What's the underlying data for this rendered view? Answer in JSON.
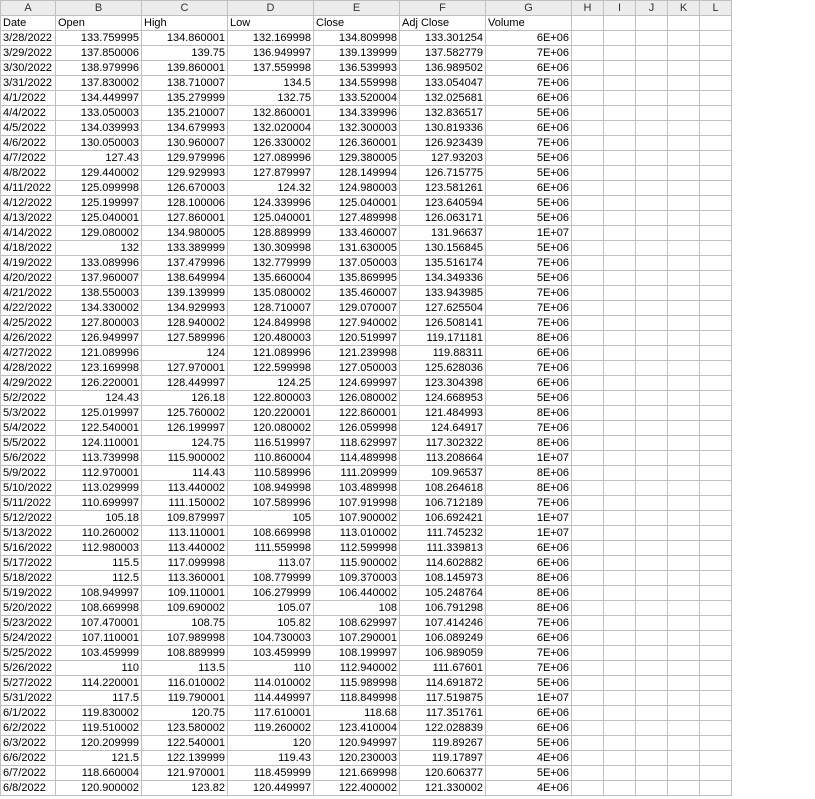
{
  "columns": [
    "A",
    "B",
    "C",
    "D",
    "E",
    "F",
    "G",
    "H",
    "I",
    "J",
    "K",
    "L"
  ],
  "headers": [
    "Date",
    "Open",
    "High",
    "Low",
    "Close",
    "Adj Close",
    "Volume",
    "",
    "",
    "",
    "",
    ""
  ],
  "rows": [
    {
      "date": "3/28/2022",
      "open": "133.759995",
      "high": "134.860001",
      "low": "132.169998",
      "close": "134.809998",
      "adj": "133.301254",
      "vol": "6E+06"
    },
    {
      "date": "3/29/2022",
      "open": "137.850006",
      "high": "139.75",
      "low": "136.949997",
      "close": "139.139999",
      "adj": "137.582779",
      "vol": "7E+06"
    },
    {
      "date": "3/30/2022",
      "open": "138.979996",
      "high": "139.860001",
      "low": "137.559998",
      "close": "136.539993",
      "adj": "136.989502",
      "vol": "6E+06"
    },
    {
      "date": "3/31/2022",
      "open": "137.830002",
      "high": "138.710007",
      "low": "134.5",
      "close": "134.559998",
      "adj": "133.054047",
      "vol": "7E+06"
    },
    {
      "date": "4/1/2022",
      "open": "134.449997",
      "high": "135.279999",
      "low": "132.75",
      "close": "133.520004",
      "adj": "132.025681",
      "vol": "6E+06"
    },
    {
      "date": "4/4/2022",
      "open": "133.050003",
      "high": "135.210007",
      "low": "132.860001",
      "close": "134.339996",
      "adj": "132.836517",
      "vol": "5E+06"
    },
    {
      "date": "4/5/2022",
      "open": "134.039993",
      "high": "134.679993",
      "low": "132.020004",
      "close": "132.300003",
      "adj": "130.819336",
      "vol": "6E+06"
    },
    {
      "date": "4/6/2022",
      "open": "130.050003",
      "high": "130.960007",
      "low": "126.330002",
      "close": "126.360001",
      "adj": "126.923439",
      "vol": "7E+06"
    },
    {
      "date": "4/7/2022",
      "open": "127.43",
      "high": "129.979996",
      "low": "127.089996",
      "close": "129.380005",
      "adj": "127.93203",
      "vol": "5E+06"
    },
    {
      "date": "4/8/2022",
      "open": "129.440002",
      "high": "129.929993",
      "low": "127.879997",
      "close": "128.149994",
      "adj": "126.715775",
      "vol": "5E+06"
    },
    {
      "date": "4/11/2022",
      "open": "125.099998",
      "high": "126.670003",
      "low": "124.32",
      "close": "124.980003",
      "adj": "123.581261",
      "vol": "6E+06"
    },
    {
      "date": "4/12/2022",
      "open": "125.199997",
      "high": "128.100006",
      "low": "124.339996",
      "close": "125.040001",
      "adj": "123.640594",
      "vol": "5E+06"
    },
    {
      "date": "4/13/2022",
      "open": "125.040001",
      "high": "127.860001",
      "low": "125.040001",
      "close": "127.489998",
      "adj": "126.063171",
      "vol": "5E+06"
    },
    {
      "date": "4/14/2022",
      "open": "129.080002",
      "high": "134.980005",
      "low": "128.889999",
      "close": "133.460007",
      "adj": "131.96637",
      "vol": "1E+07"
    },
    {
      "date": "4/18/2022",
      "open": "132",
      "high": "133.389999",
      "low": "130.309998",
      "close": "131.630005",
      "adj": "130.156845",
      "vol": "5E+06"
    },
    {
      "date": "4/19/2022",
      "open": "133.089996",
      "high": "137.479996",
      "low": "132.779999",
      "close": "137.050003",
      "adj": "135.516174",
      "vol": "7E+06"
    },
    {
      "date": "4/20/2022",
      "open": "137.960007",
      "high": "138.649994",
      "low": "135.660004",
      "close": "135.869995",
      "adj": "134.349336",
      "vol": "5E+06"
    },
    {
      "date": "4/21/2022",
      "open": "138.550003",
      "high": "139.139999",
      "low": "135.080002",
      "close": "135.460007",
      "adj": "133.943985",
      "vol": "7E+06"
    },
    {
      "date": "4/22/2022",
      "open": "134.330002",
      "high": "134.929993",
      "low": "128.710007",
      "close": "129.070007",
      "adj": "127.625504",
      "vol": "7E+06"
    },
    {
      "date": "4/25/2022",
      "open": "127.800003",
      "high": "128.940002",
      "low": "124.849998",
      "close": "127.940002",
      "adj": "126.508141",
      "vol": "7E+06"
    },
    {
      "date": "4/26/2022",
      "open": "126.949997",
      "high": "127.589996",
      "low": "120.480003",
      "close": "120.519997",
      "adj": "119.171181",
      "vol": "8E+06"
    },
    {
      "date": "4/27/2022",
      "open": "121.089996",
      "high": "124",
      "low": "121.089996",
      "close": "121.239998",
      "adj": "119.88311",
      "vol": "6E+06"
    },
    {
      "date": "4/28/2022",
      "open": "123.169998",
      "high": "127.970001",
      "low": "122.599998",
      "close": "127.050003",
      "adj": "125.628036",
      "vol": "7E+06"
    },
    {
      "date": "4/29/2022",
      "open": "126.220001",
      "high": "128.449997",
      "low": "124.25",
      "close": "124.699997",
      "adj": "123.304398",
      "vol": "6E+06"
    },
    {
      "date": "5/2/2022",
      "open": "124.43",
      "high": "126.18",
      "low": "122.800003",
      "close": "126.080002",
      "adj": "124.668953",
      "vol": "5E+06"
    },
    {
      "date": "5/3/2022",
      "open": "125.019997",
      "high": "125.760002",
      "low": "120.220001",
      "close": "122.860001",
      "adj": "121.484993",
      "vol": "8E+06"
    },
    {
      "date": "5/4/2022",
      "open": "122.540001",
      "high": "126.199997",
      "low": "120.080002",
      "close": "126.059998",
      "adj": "124.64917",
      "vol": "7E+06"
    },
    {
      "date": "5/5/2022",
      "open": "124.110001",
      "high": "124.75",
      "low": "116.519997",
      "close": "118.629997",
      "adj": "117.302322",
      "vol": "8E+06"
    },
    {
      "date": "5/6/2022",
      "open": "113.739998",
      "high": "115.900002",
      "low": "110.860004",
      "close": "114.489998",
      "adj": "113.208664",
      "vol": "1E+07"
    },
    {
      "date": "5/9/2022",
      "open": "112.970001",
      "high": "114.43",
      "low": "110.589996",
      "close": "111.209999",
      "adj": "109.96537",
      "vol": "8E+06"
    },
    {
      "date": "5/10/2022",
      "open": "113.029999",
      "high": "113.440002",
      "low": "108.949998",
      "close": "103.489998",
      "adj": "108.264618",
      "vol": "8E+06"
    },
    {
      "date": "5/11/2022",
      "open": "110.699997",
      "high": "111.150002",
      "low": "107.589996",
      "close": "107.919998",
      "adj": "106.712189",
      "vol": "7E+06"
    },
    {
      "date": "5/12/2022",
      "open": "105.18",
      "high": "109.879997",
      "low": "105",
      "close": "107.900002",
      "adj": "106.692421",
      "vol": "1E+07"
    },
    {
      "date": "5/13/2022",
      "open": "110.260002",
      "high": "113.110001",
      "low": "108.669998",
      "close": "113.010002",
      "adj": "111.745232",
      "vol": "1E+07"
    },
    {
      "date": "5/16/2022",
      "open": "112.980003",
      "high": "113.440002",
      "low": "111.559998",
      "close": "112.599998",
      "adj": "111.339813",
      "vol": "6E+06"
    },
    {
      "date": "5/17/2022",
      "open": "115.5",
      "high": "117.099998",
      "low": "113.07",
      "close": "115.900002",
      "adj": "114.602882",
      "vol": "6E+06"
    },
    {
      "date": "5/18/2022",
      "open": "112.5",
      "high": "113.360001",
      "low": "108.779999",
      "close": "109.370003",
      "adj": "108.145973",
      "vol": "8E+06"
    },
    {
      "date": "5/19/2022",
      "open": "108.949997",
      "high": "109.110001",
      "low": "106.279999",
      "close": "106.440002",
      "adj": "105.248764",
      "vol": "8E+06"
    },
    {
      "date": "5/20/2022",
      "open": "108.669998",
      "high": "109.690002",
      "low": "105.07",
      "close": "108",
      "adj": "106.791298",
      "vol": "8E+06"
    },
    {
      "date": "5/23/2022",
      "open": "107.470001",
      "high": "108.75",
      "low": "105.82",
      "close": "108.629997",
      "adj": "107.414246",
      "vol": "7E+06"
    },
    {
      "date": "5/24/2022",
      "open": "107.110001",
      "high": "107.989998",
      "low": "104.730003",
      "close": "107.290001",
      "adj": "106.089249",
      "vol": "6E+06"
    },
    {
      "date": "5/25/2022",
      "open": "103.459999",
      "high": "108.889999",
      "low": "103.459999",
      "close": "108.199997",
      "adj": "106.989059",
      "vol": "7E+06"
    },
    {
      "date": "5/26/2022",
      "open": "110",
      "high": "113.5",
      "low": "110",
      "close": "112.940002",
      "adj": "111.67601",
      "vol": "7E+06"
    },
    {
      "date": "5/27/2022",
      "open": "114.220001",
      "high": "116.010002",
      "low": "114.010002",
      "close": "115.989998",
      "adj": "114.691872",
      "vol": "5E+06"
    },
    {
      "date": "5/31/2022",
      "open": "117.5",
      "high": "119.790001",
      "low": "114.449997",
      "close": "118.849998",
      "adj": "117.519875",
      "vol": "1E+07"
    },
    {
      "date": "6/1/2022",
      "open": "119.830002",
      "high": "120.75",
      "low": "117.610001",
      "close": "118.68",
      "adj": "117.351761",
      "vol": "6E+06"
    },
    {
      "date": "6/2/2022",
      "open": "119.510002",
      "high": "123.580002",
      "low": "119.260002",
      "close": "123.410004",
      "adj": "122.028839",
      "vol": "6E+06"
    },
    {
      "date": "6/3/2022",
      "open": "120.209999",
      "high": "122.540001",
      "low": "120",
      "close": "120.949997",
      "adj": "119.89267",
      "vol": "5E+06"
    },
    {
      "date": "6/6/2022",
      "open": "121.5",
      "high": "122.139999",
      "low": "119.43",
      "close": "120.230003",
      "adj": "119.17897",
      "vol": "4E+06"
    },
    {
      "date": "6/7/2022",
      "open": "118.660004",
      "high": "121.970001",
      "low": "118.459999",
      "close": "121.669998",
      "adj": "120.606377",
      "vol": "5E+06"
    },
    {
      "date": "6/8/2022",
      "open": "120.900002",
      "high": "123.82",
      "low": "120.449997",
      "close": "122.400002",
      "adj": "121.330002",
      "vol": "4E+06"
    }
  ]
}
